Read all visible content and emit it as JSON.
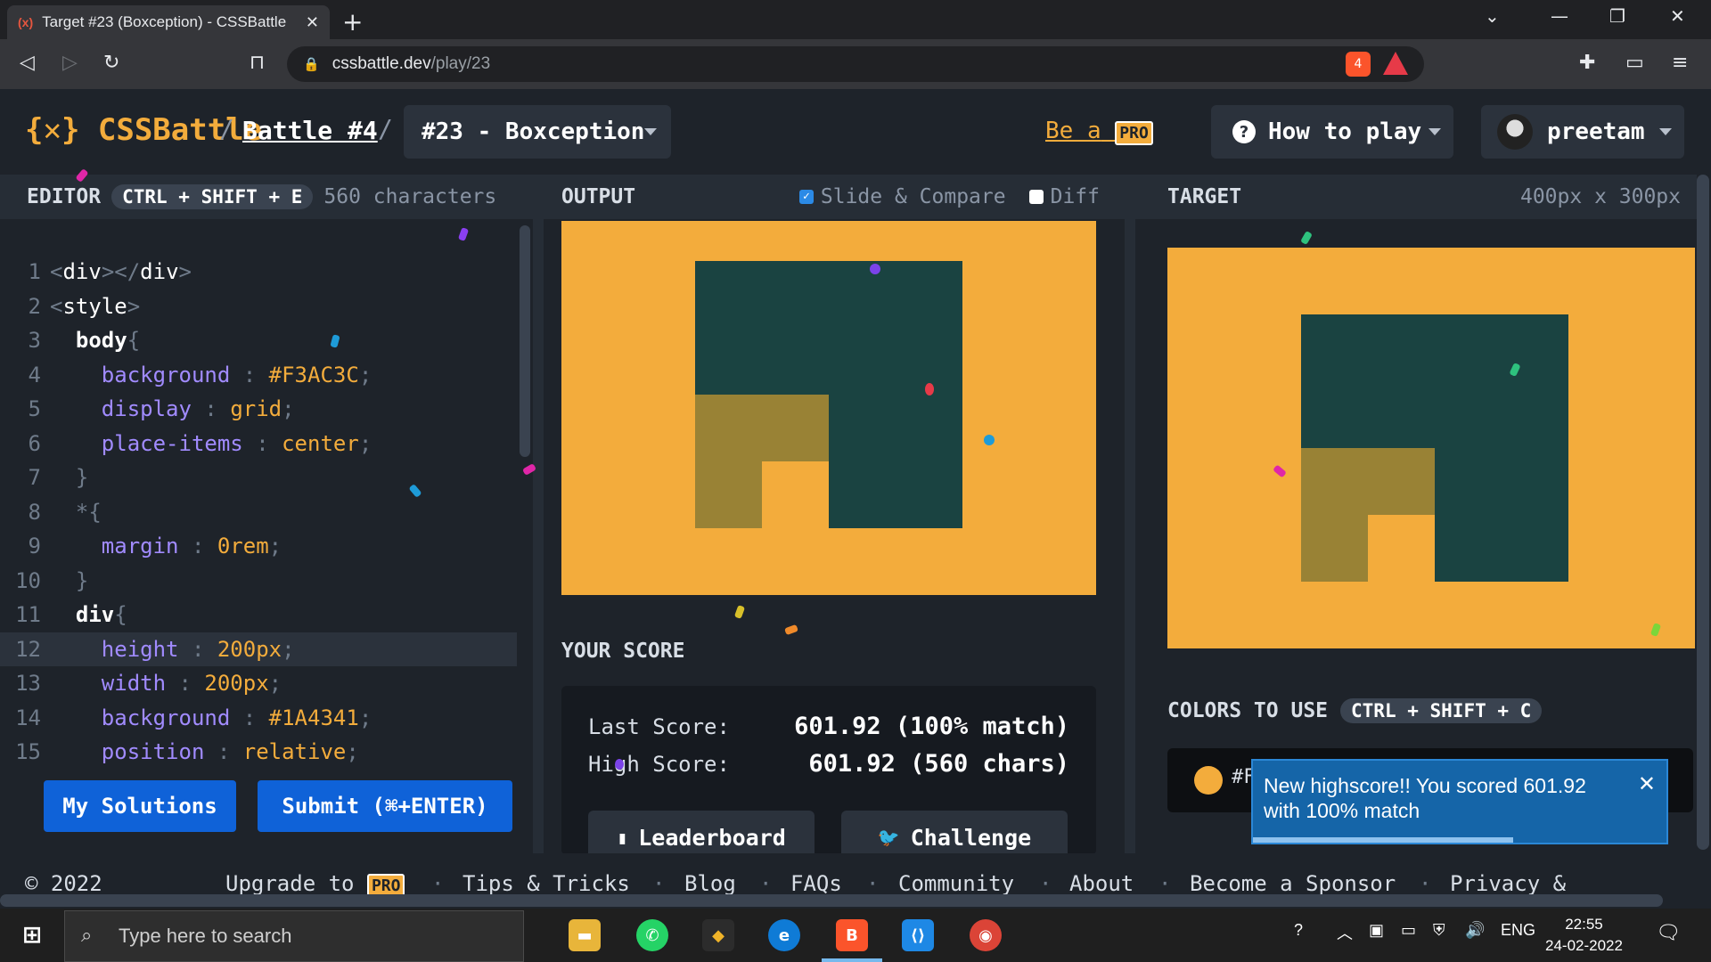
{
  "browser": {
    "tab_favicon": "(x)",
    "tab_title": "Target #23 (Boxception) - CSSBattle",
    "tab_close": "✕",
    "new_tab": "+",
    "url_host": "cssbattle.dev",
    "url_path": "/play/23",
    "brave_badge": "4"
  },
  "header": {
    "logo": "{✕} CSSBattle",
    "sep": "/",
    "battle_link": "Battle #4",
    "target_select": "#23 - Boxception",
    "be_a": "Be a",
    "pro": "PRO",
    "how_to_play": "How to play",
    "username": "preetam"
  },
  "editor": {
    "title": "EDITOR",
    "shortcut": "CTRL + SHIFT + E",
    "char_count": "560 characters",
    "lines": [
      {
        "n": "1",
        "parts": [
          [
            "punc",
            "<"
          ],
          [
            "tag",
            "div"
          ],
          [
            "punc",
            "></"
          ],
          [
            "tag",
            "div"
          ],
          [
            "punc",
            ">"
          ]
        ]
      },
      {
        "n": "2",
        "parts": [
          [
            "punc",
            "<"
          ],
          [
            "tag",
            "style"
          ],
          [
            "punc",
            ">"
          ]
        ]
      },
      {
        "n": "3",
        "parts": [
          [
            "sel",
            "  body"
          ],
          [
            "punc",
            "{"
          ]
        ]
      },
      {
        "n": "4",
        "parts": [
          [
            "prop",
            "    background"
          ],
          [
            "punc",
            " : "
          ],
          [
            "val",
            "#F3AC3C"
          ],
          [
            "punc",
            ";"
          ]
        ]
      },
      {
        "n": "5",
        "parts": [
          [
            "prop",
            "    display"
          ],
          [
            "punc",
            " : "
          ],
          [
            "val",
            "grid"
          ],
          [
            "punc",
            ";"
          ]
        ]
      },
      {
        "n": "6",
        "parts": [
          [
            "prop",
            "    place-items"
          ],
          [
            "punc",
            " : "
          ],
          [
            "val",
            "center"
          ],
          [
            "punc",
            ";"
          ]
        ]
      },
      {
        "n": "7",
        "parts": [
          [
            "punc",
            "  }"
          ]
        ]
      },
      {
        "n": "8",
        "parts": [
          [
            "punc",
            "  *{"
          ]
        ]
      },
      {
        "n": "9",
        "parts": [
          [
            "prop",
            "    margin"
          ],
          [
            "punc",
            " : "
          ],
          [
            "val",
            "0rem"
          ],
          [
            "punc",
            ";"
          ]
        ]
      },
      {
        "n": "10",
        "parts": [
          [
            "punc",
            "  }"
          ]
        ]
      },
      {
        "n": "11",
        "parts": [
          [
            "sel",
            "  div"
          ],
          [
            "punc",
            "{"
          ]
        ]
      },
      {
        "n": "12",
        "parts": [
          [
            "prop",
            "    height"
          ],
          [
            "punc",
            " : "
          ],
          [
            "val",
            "200px"
          ],
          [
            "punc",
            ";"
          ]
        ]
      },
      {
        "n": "13",
        "parts": [
          [
            "prop",
            "    width"
          ],
          [
            "punc",
            " : "
          ],
          [
            "val",
            "200px"
          ],
          [
            "punc",
            ";"
          ]
        ]
      },
      {
        "n": "14",
        "parts": [
          [
            "prop",
            "    background"
          ],
          [
            "punc",
            " : "
          ],
          [
            "val",
            "#1A4341"
          ],
          [
            "punc",
            ";"
          ]
        ]
      },
      {
        "n": "15",
        "parts": [
          [
            "prop",
            "    position"
          ],
          [
            "punc",
            " : "
          ],
          [
            "val",
            "relative"
          ],
          [
            "punc",
            ";"
          ]
        ]
      }
    ],
    "my_solutions": "My Solutions",
    "submit": "Submit (⌘+ENTER)"
  },
  "output": {
    "title": "OUTPUT",
    "slide_compare": "Slide & Compare",
    "slide_checked": true,
    "diff": "Diff",
    "diff_checked": false
  },
  "score": {
    "title": "YOUR SCORE",
    "last_label": "Last Score:",
    "last_value": "601.92 (100% match)",
    "high_label": "High Score:",
    "high_value": "601.92 (560 chars)",
    "leaderboard": "Leaderboard",
    "challenge": "Challenge"
  },
  "target": {
    "title": "TARGET",
    "size": "400px x 300px",
    "colors_title": "COLORS TO USE",
    "colors_shortcut": "CTRL + SHIFT + C",
    "color_prefix": "#F"
  },
  "toast": {
    "message": "New highscore!! You scored 601.92 with 100% match",
    "close": "✕",
    "progress": 0.63
  },
  "footer": {
    "copyright": "© 2022",
    "upgrade": "Upgrade to",
    "pro": "PRO",
    "links": [
      "Tips & Tricks",
      "Blog",
      "FAQs",
      "Community",
      "About",
      "Become a Sponsor",
      "Privacy &"
    ]
  },
  "taskbar": {
    "search_placeholder": "Type here to search",
    "lang": "ENG",
    "time": "22:55",
    "date": "24-02-2022"
  },
  "colors": {
    "orange": "#F3AC3C",
    "teal": "#1A4341",
    "olive": "#998235",
    "accent_blue": "#0F62D8"
  }
}
